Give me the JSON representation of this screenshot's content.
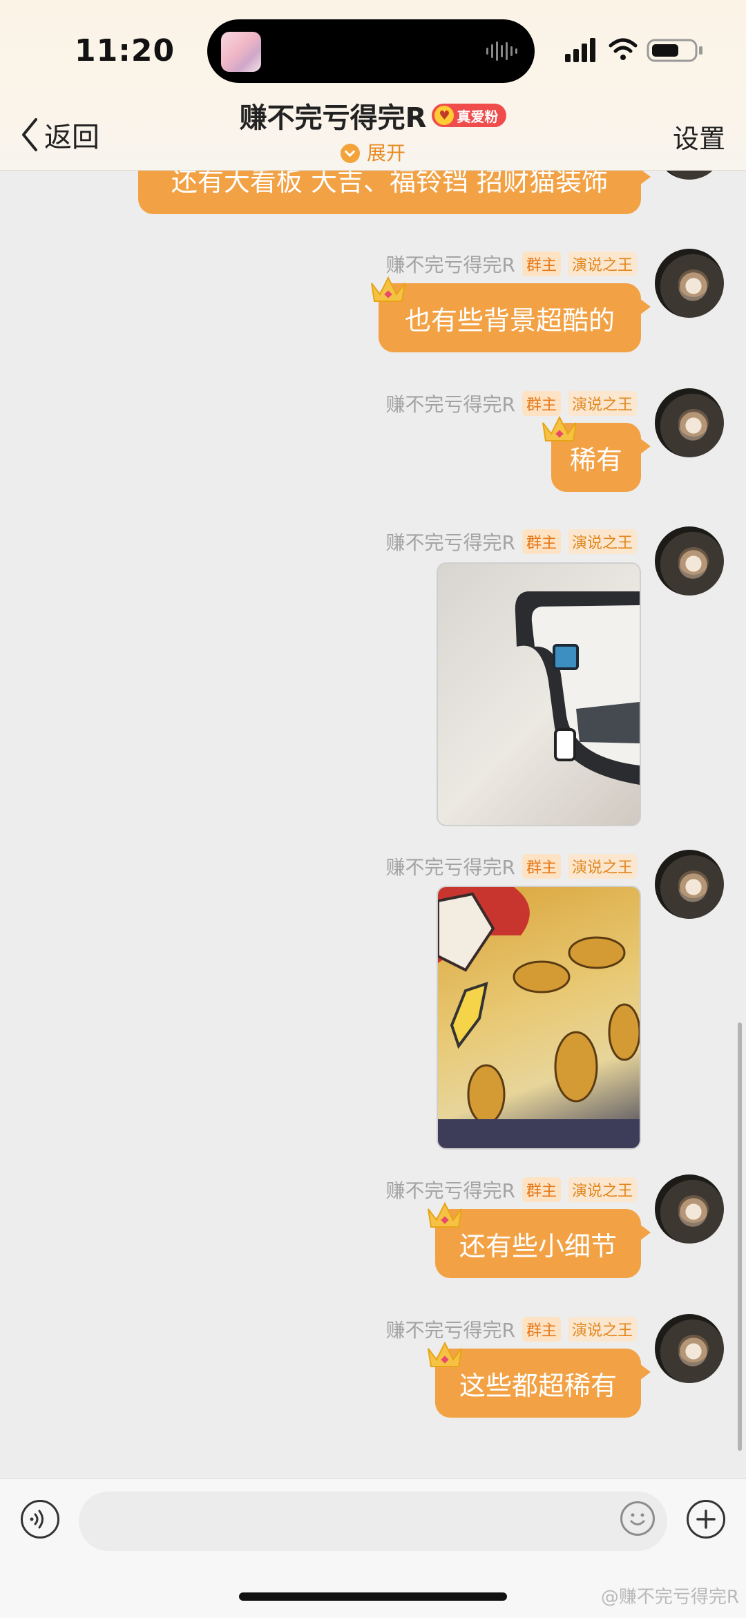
{
  "status_bar": {
    "time": "11:20"
  },
  "header": {
    "back_label": "返回",
    "title": "赚不完亏得完R",
    "fan_badge": "真爱粉",
    "expand_label": "展开",
    "settings_label": "设置"
  },
  "messages": [
    {
      "type": "text",
      "text": "还有大看板 大吉、福铃铛 招财猫装饰"
    },
    {
      "type": "text",
      "sender": "赚不完亏得完R",
      "tags": [
        "群主",
        "演说之王"
      ],
      "text": "也有些背景超酷的"
    },
    {
      "type": "text",
      "sender": "赚不完亏得完R",
      "tags": [
        "群主",
        "演说之王"
      ],
      "text": "稀有"
    },
    {
      "type": "image",
      "sender": "赚不完亏得完R",
      "tags": [
        "群主",
        "演说之王"
      ]
    },
    {
      "type": "image",
      "sender": "赚不完亏得完R",
      "tags": [
        "群主",
        "演说之王"
      ]
    },
    {
      "type": "text",
      "sender": "赚不完亏得完R",
      "tags": [
        "群主",
        "演说之王"
      ],
      "text": "还有些小细节"
    },
    {
      "type": "text",
      "sender": "赚不完亏得完R",
      "tags": [
        "群主",
        "演说之王"
      ],
      "text": "这些都超稀有"
    }
  ],
  "input": {
    "placeholder": ""
  },
  "watermark": "@赚不完亏得完R",
  "colors": {
    "bubble": "#f2a245",
    "expand": "#e88a1f",
    "tag_text": "#e2861c"
  }
}
